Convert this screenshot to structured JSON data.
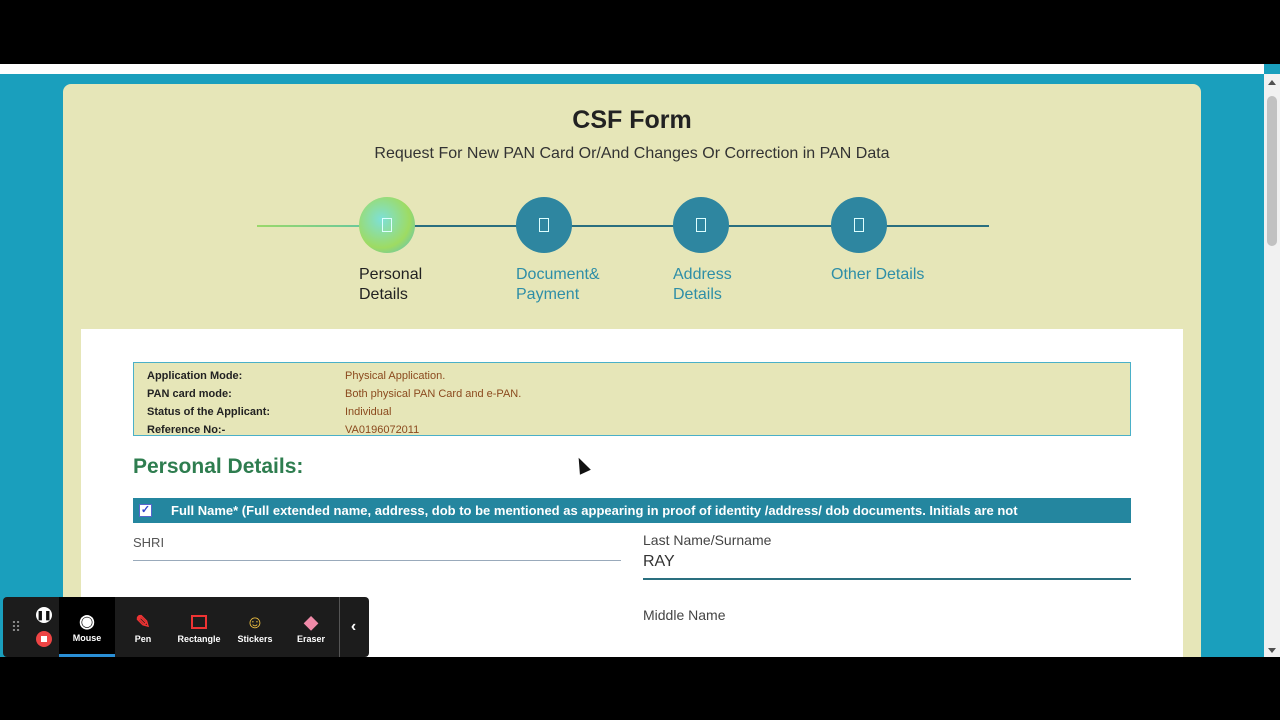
{
  "form": {
    "title": "CSF Form",
    "subtitle": "Request For New PAN Card Or/And Changes Or Correction in PAN Data"
  },
  "steps": [
    {
      "label": "Personal Details",
      "state": "active"
    },
    {
      "label": "Document& Payment",
      "state": "pending"
    },
    {
      "label": "Address Details",
      "state": "pending"
    },
    {
      "label": "Other Details",
      "state": "pending"
    }
  ],
  "info": {
    "rows": [
      {
        "key": "Application Mode:",
        "value": "Physical Application."
      },
      {
        "key": "PAN card mode:",
        "value": "Both physical PAN Card and e-PAN."
      },
      {
        "key": "Status of the Applicant:",
        "value": "Individual"
      },
      {
        "key": "Reference No:-",
        "value": "VA0196072011"
      }
    ]
  },
  "personal": {
    "heading": "Personal Details:",
    "fullname_bar": "Full Name* (Full extended name, address, dob to be mentioned as appearing in proof of identity /address/ dob documents. Initials are not",
    "checkbox_mark": "✓",
    "title_value": "SHRI",
    "last_name_label": "Last Name/Surname",
    "last_name_value": "RAY",
    "middle_name_label": "Middle Name"
  },
  "toolbar": {
    "grip": "⠿",
    "pause": "❚❚",
    "tools": [
      {
        "label": "Mouse",
        "icon": "mouse-cursor-icon",
        "glyph": "◉",
        "selected": true
      },
      {
        "label": "Pen",
        "icon": "pen-icon",
        "glyph": "✎",
        "selected": false
      },
      {
        "label": "Rectangle",
        "icon": "rectangle-icon",
        "glyph": "",
        "selected": false
      },
      {
        "label": "Stickers",
        "icon": "sticker-icon",
        "glyph": "☺",
        "selected": false
      },
      {
        "label": "Eraser",
        "icon": "eraser-icon",
        "glyph": "◆",
        "selected": false
      }
    ],
    "collapse": "‹"
  },
  "colors": {
    "page_bg": "#1a9fbd",
    "card_bg": "#e6e6b8",
    "accent": "#24869f",
    "heading_green": "#2e7d4f",
    "value_brown": "#8b4a1e"
  }
}
